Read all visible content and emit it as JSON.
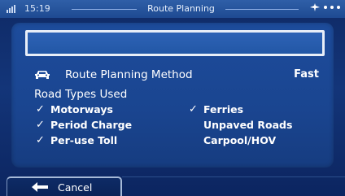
{
  "status_bar": {
    "time": "15:19",
    "title": "Route Planning"
  },
  "search": {
    "value": ""
  },
  "route_method": {
    "label": "Route Planning Method",
    "value": "Fast"
  },
  "road_types": {
    "title": "Road Types Used",
    "items": [
      {
        "label": "Motorways",
        "checked": true
      },
      {
        "label": "Period Charge",
        "checked": true
      },
      {
        "label": "Per-use Toll",
        "checked": true
      },
      {
        "label": "Ferries",
        "checked": true
      },
      {
        "label": "Unpaved Roads",
        "checked": false
      },
      {
        "label": "Carpool/HOV",
        "checked": false
      }
    ]
  },
  "footer": {
    "cancel_label": "Cancel"
  },
  "icons": {
    "car": "car-icon",
    "back_arrow": "arrow-left-icon",
    "signal": "signal-icon",
    "gps": "gps-icon"
  },
  "colors": {
    "background": "#0f2a66",
    "panel": "#1d4c9c",
    "status_bar": "#2f5fa8",
    "text": "#ffffff"
  }
}
